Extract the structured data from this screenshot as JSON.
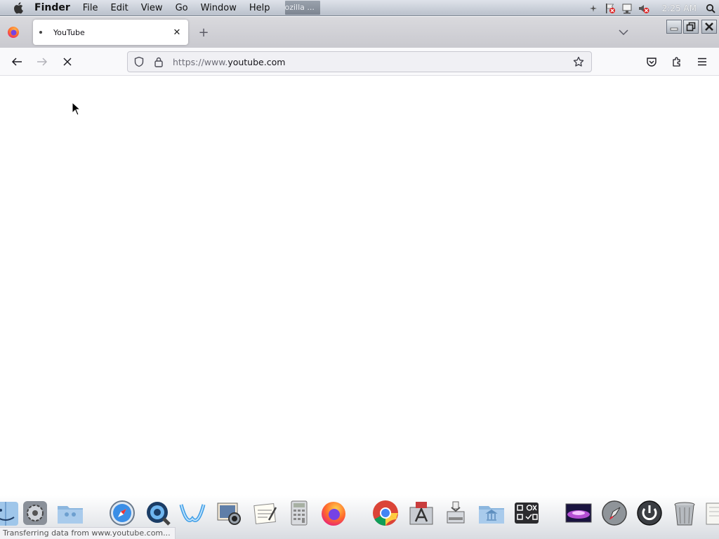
{
  "menubar": {
    "app_name": "Finder",
    "items": [
      "File",
      "Edit",
      "View",
      "Go",
      "Window",
      "Help"
    ],
    "task_chip": "ozilla ...",
    "clock": "2:25 AM"
  },
  "browser": {
    "tab": {
      "title": "YouTube",
      "close_glyph": "✕"
    },
    "new_tab_glyph": "+",
    "url": {
      "prefix": "https://www.",
      "host": "youtube.com"
    },
    "status_text": "Transferring data from www.youtube.com..."
  },
  "icons": {
    "menubar": [
      "apple-icon"
    ],
    "tray": [
      "spaces-icon",
      "flag-icon",
      "network-icon",
      "volume-muted-icon",
      "spotlight-icon"
    ],
    "navbar": [
      "back-icon",
      "forward-icon",
      "stop-icon",
      "shield-icon",
      "lock-icon",
      "star-icon",
      "pocket-icon",
      "extensions-icon",
      "hamburger-menu-icon"
    ],
    "dock": [
      "finder-icon",
      "system-preferences-icon",
      "users-folder-icon",
      "safari-icon",
      "quicktime-icon",
      "mail-icon",
      "photo-icon",
      "textedit-icon",
      "calculator-icon",
      "firefox-icon",
      "chrome-icon",
      "app-store-icon",
      "disk-utility-icon",
      "applications-folder-icon",
      "widgets-icon",
      "desktop-picture-icon",
      "launchpad-icon",
      "power-icon",
      "trash-icon",
      "notes-icon"
    ]
  },
  "colors": {
    "url_dim": "#6e6e78",
    "toolbar_bg": "#f9f9fb",
    "tab_strip_bg": "#d9d9dd"
  }
}
